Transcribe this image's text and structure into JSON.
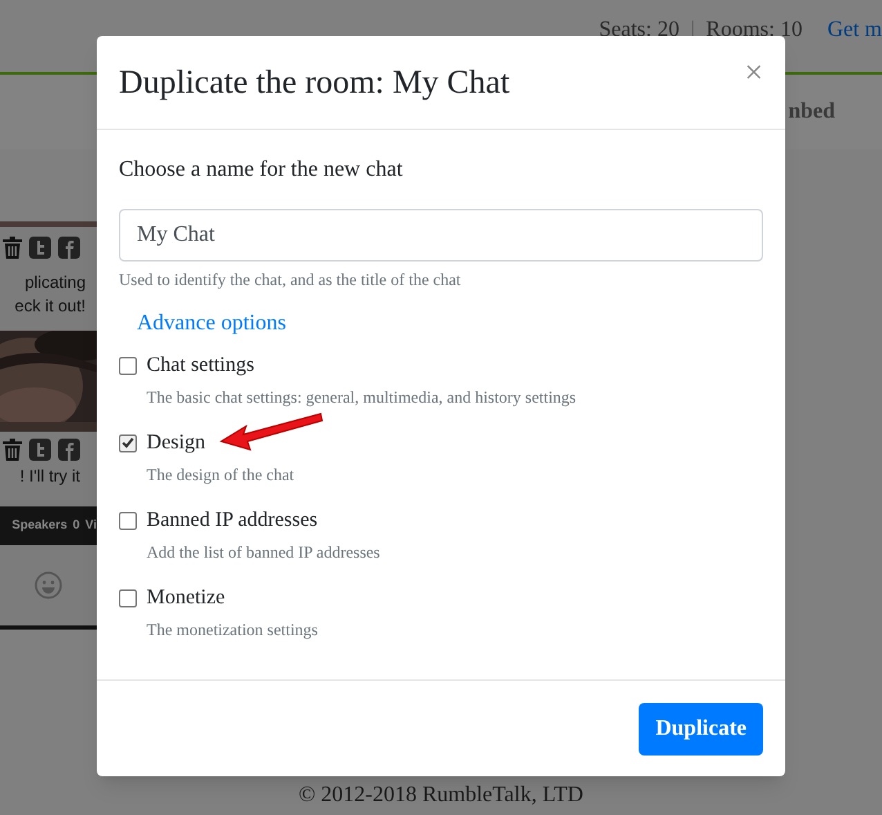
{
  "header_bar": {
    "seats": "Seats: 20",
    "separator": "|",
    "rooms": "Rooms: 10",
    "link": "Get m"
  },
  "nav": {
    "item": "nbed"
  },
  "chat_widget": {
    "messages": [
      {
        "lines": [
          "plicating",
          "eck it out!"
        ]
      },
      {
        "lines": [
          "! I'll try it"
        ]
      }
    ],
    "status": {
      "label": "Speakers",
      "count": "0",
      "extra": "Vi"
    }
  },
  "footer": "© 2012-2018 RumbleTalk, LTD",
  "dialog": {
    "title": "Duplicate the room: My Chat",
    "close": "×",
    "name_label": "Choose a name for the new chat",
    "name_field": {
      "value": "My Chat"
    },
    "help": "Used to identify the chat, and as the title of the chat",
    "advanced_link": "Advance options",
    "options": [
      {
        "label": "Chat settings",
        "description": "The basic chat settings: general, multimedia, and history settings",
        "checked": false
      },
      {
        "label": "Design",
        "description": "The design of the chat",
        "checked": true,
        "annotated": true
      },
      {
        "label": "Banned IP addresses",
        "description": "Add the list of banned IP addresses",
        "checked": false
      },
      {
        "label": "Monetize",
        "description": "The monetization settings",
        "checked": false
      }
    ],
    "buttons": [
      "Duplicate"
    ]
  }
}
